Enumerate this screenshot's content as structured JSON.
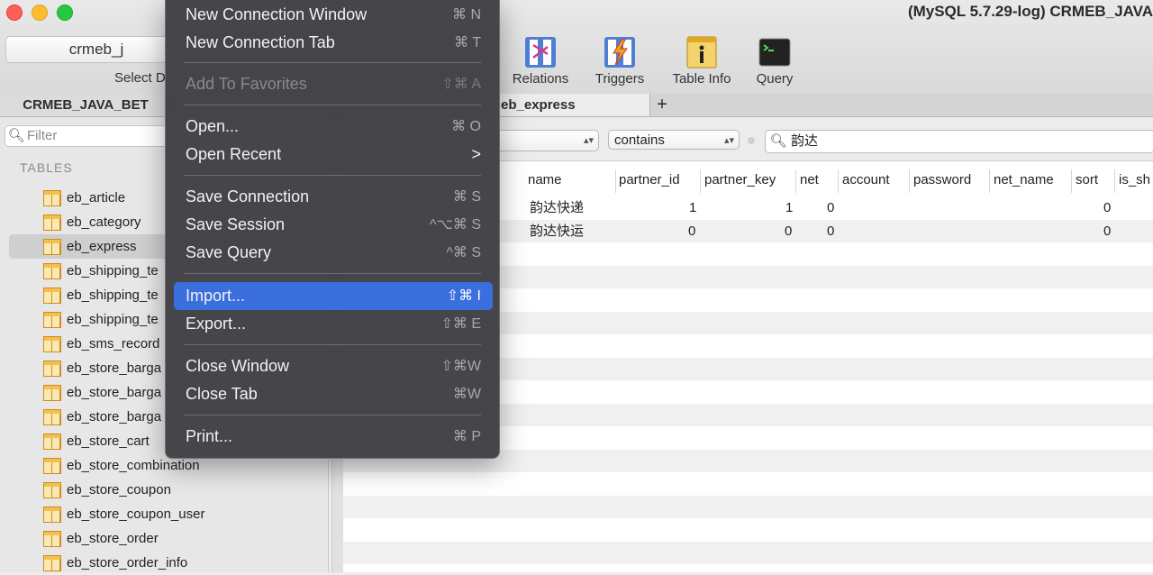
{
  "window": {
    "title": "(MySQL 5.7.29-log) CRMEB_JAVA",
    "database_select": "crmeb_j",
    "database_caption": "Select D"
  },
  "toolbar": {
    "items": [
      {
        "label": "Relations",
        "icon": "relations-icon"
      },
      {
        "label": "Triggers",
        "icon": "triggers-icon"
      },
      {
        "label": "Table Info",
        "icon": "table-info-icon"
      },
      {
        "label": "Query",
        "icon": "query-icon"
      }
    ]
  },
  "tabs": {
    "first": "CRMEB_JAVA_BET",
    "second": "eb_express",
    "add": "+"
  },
  "sidebar": {
    "filter_placeholder": "Filter",
    "header": "TABLES",
    "tables": [
      "eb_article",
      "eb_category",
      "eb_express",
      "eb_shipping_te",
      "eb_shipping_te",
      "eb_shipping_te",
      "eb_sms_record",
      "eb_store_barga",
      "eb_store_barga",
      "eb_store_barga",
      "eb_store_cart",
      "eb_store_combination",
      "eb_store_coupon",
      "eb_store_coupon_user",
      "eb_store_order",
      "eb_store_order_info"
    ],
    "selected_index": 2
  },
  "filter_bar": {
    "field": "",
    "operator": "contains",
    "search_value": "韵达"
  },
  "table": {
    "columns": [
      "name",
      "partner_id",
      "partner_key",
      "net",
      "account",
      "password",
      "net_name",
      "sort",
      "is_sh"
    ],
    "rows": [
      {
        "name": "韵达快递",
        "partner_id": "1",
        "partner_key": "1",
        "net": "0",
        "sort": "0"
      },
      {
        "name": "韵达快运",
        "partner_id": "0",
        "partner_key": "0",
        "net": "0",
        "sort": "0"
      }
    ]
  },
  "menu": {
    "items": [
      {
        "label": "New Connection Window",
        "shortcut": "⌘ N"
      },
      {
        "label": "New Connection Tab",
        "shortcut": "⌘ T"
      },
      {
        "label": "Add To Favorites",
        "shortcut": "⇧⌘ A"
      },
      {
        "label": "Open...",
        "shortcut": "⌘ O"
      },
      {
        "label": "Open Recent",
        "shortcut": ">"
      },
      {
        "label": "Save Connection",
        "shortcut": "⌘ S"
      },
      {
        "label": "Save Session",
        "shortcut": "^⌥⌘ S"
      },
      {
        "label": "Save Query",
        "shortcut": "^⌘ S"
      },
      {
        "label": "Import...",
        "shortcut": "⇧⌘ I"
      },
      {
        "label": "Export...",
        "shortcut": "⇧⌘ E"
      },
      {
        "label": "Close Window",
        "shortcut": "⇧⌘W"
      },
      {
        "label": "Close Tab",
        "shortcut": "⌘W"
      },
      {
        "label": "Print...",
        "shortcut": "⌘ P"
      }
    ]
  }
}
